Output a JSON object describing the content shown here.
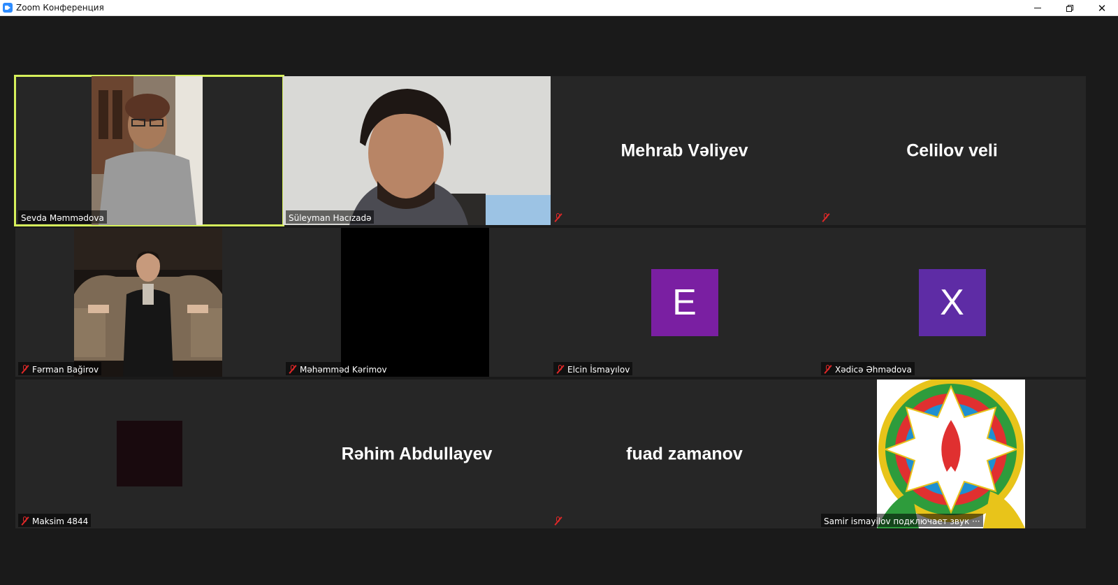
{
  "window": {
    "title": "Zoom Конференция"
  },
  "participants": [
    {
      "display_name": "",
      "label": "Sevda Məmmədova",
      "muted": false,
      "active_speaker": true,
      "video": "camera"
    },
    {
      "display_name": "",
      "label": "Süleyman Hacızadə",
      "muted": false,
      "active_speaker": false,
      "video": "camera"
    },
    {
      "display_name": "Mehrab Vəliyev",
      "label": "",
      "muted": true,
      "video": "off"
    },
    {
      "display_name": "Celilov veli",
      "label": "",
      "muted": true,
      "video": "off"
    },
    {
      "display_name": "",
      "label": "Fərman Bağirov",
      "muted": true,
      "video": "picture"
    },
    {
      "display_name": "",
      "label": "Məhəmməd Kərimov",
      "muted": true,
      "video": "black"
    },
    {
      "display_name": "",
      "label": "Elcin İsmayılov",
      "muted": true,
      "video": "avatar",
      "avatar_letter": "E",
      "avatar_color": "#7a1fa2"
    },
    {
      "display_name": "",
      "label": "Xədicə Əhmədova",
      "muted": true,
      "video": "avatar",
      "avatar_letter": "X",
      "avatar_color": "#5e2ca5"
    },
    {
      "display_name": "",
      "label": "Maksim 4844",
      "muted": true,
      "video": "dark-square"
    },
    {
      "display_name": "Rəhim Abdullayev",
      "label": "",
      "muted": false,
      "video": "off"
    },
    {
      "display_name": "fuad zamanov",
      "label": "",
      "muted": true,
      "video": "off"
    },
    {
      "display_name": "",
      "label": "Samir ismayilov подключает звук ···",
      "muted": false,
      "video": "emblem"
    }
  ],
  "colors": {
    "active_speaker_border": "#d6f05b",
    "muted_icon": "#e02828",
    "background": "#1a1a1a",
    "tile": "#262626"
  }
}
